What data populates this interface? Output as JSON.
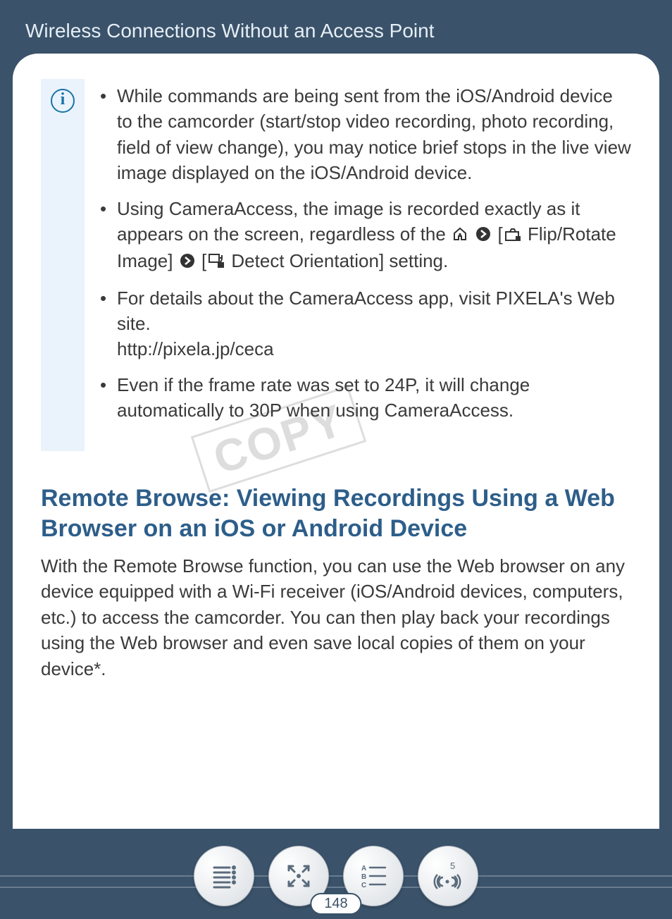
{
  "header": {
    "title": "Wireless Connections Without an Access Point"
  },
  "info": {
    "bullets": [
      "While commands are being sent from the iOS/Android device to the camcorder (start/stop video recording, photo recording, field of view change), you may notice brief stops in the live view image displayed on the iOS/Android device.",
      {
        "pre": "Using CameraAccess, the image is recorded exactly as it appears on the screen, regardless of the ",
        "flip_label": " Flip/Rotate Image",
        "detect_label": " Detect Orientation",
        "post": " setting."
      },
      {
        "lead": "For details about the CameraAccess app, visit PIXELA's Web site.",
        "url": "http://pixela.jp/ceca"
      },
      "Even if the frame rate was set to 24P, it will change automatically to 30P when using CameraAccess."
    ]
  },
  "section": {
    "heading": "Remote Browse: Viewing Recordings Using a Web Browser on an iOS or Android Device",
    "body": "With the Remote Browse function, you can use the Web browser on any device equipped with a Wi-Fi receiver (iOS/Android devices, computers, etc.) to access the camcorder. You can then play back your recordings using the Web browser and even save local copies of them on your device*."
  },
  "watermark": "COPY",
  "footer": {
    "page_number": "148",
    "wifi_badge": "5"
  }
}
